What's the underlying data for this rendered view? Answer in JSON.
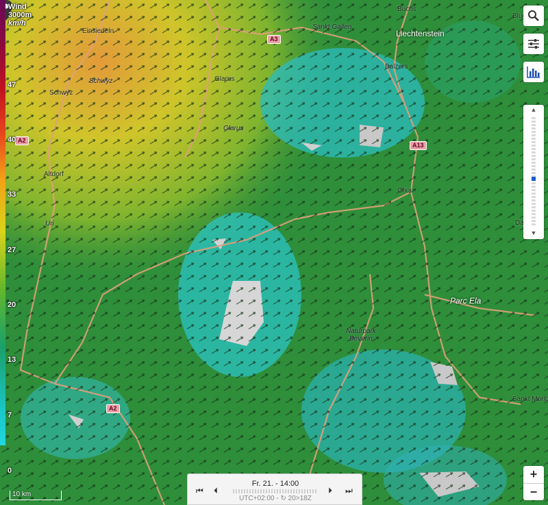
{
  "legend": {
    "title": "Wind",
    "altitude": "3000m",
    "unit": "km/h",
    "ticks": [
      "47",
      "40",
      "33",
      "27",
      "20",
      "13",
      "7",
      "0"
    ]
  },
  "labels": {
    "einsiedeln": "Einsiedeln",
    "schwyz_region": "Schwyz",
    "schwyz_town": "Schwyz",
    "glarus_top": "Glarus",
    "glarus_mid": "Glarus",
    "altdorf": "Altdorf",
    "uri": "Uri",
    "sankt_gallen": "Sankt Gallen",
    "liechtenstein": "Liechtenstein",
    "buchs": "Buchs",
    "balzers": "Balzers",
    "chur": "Chur",
    "parc_ela": "Parc Ela",
    "naturpark_line1": "Naturpark",
    "naturpark_line2": "Beverin",
    "sankt_moritz": "Sankt Moritz",
    "dav": "Dav",
    "blud": "Blud"
  },
  "shields": {
    "a3": "A3",
    "a2_top": "A2",
    "a13": "A13",
    "a2_bottom": "A2"
  },
  "toolbar": {
    "icons": [
      "search-icon",
      "sliders-icon",
      "chart-icon"
    ]
  },
  "zoom": {
    "in": "+",
    "out": "−"
  },
  "scale_label": "10 km",
  "timebar": {
    "datetime": "Fr. 21. - 14:00",
    "timezone": "UTC+02:00 - ↻ 20>18Z",
    "controls": [
      "⏮",
      "⏴",
      "⏵",
      "⏭"
    ]
  }
}
